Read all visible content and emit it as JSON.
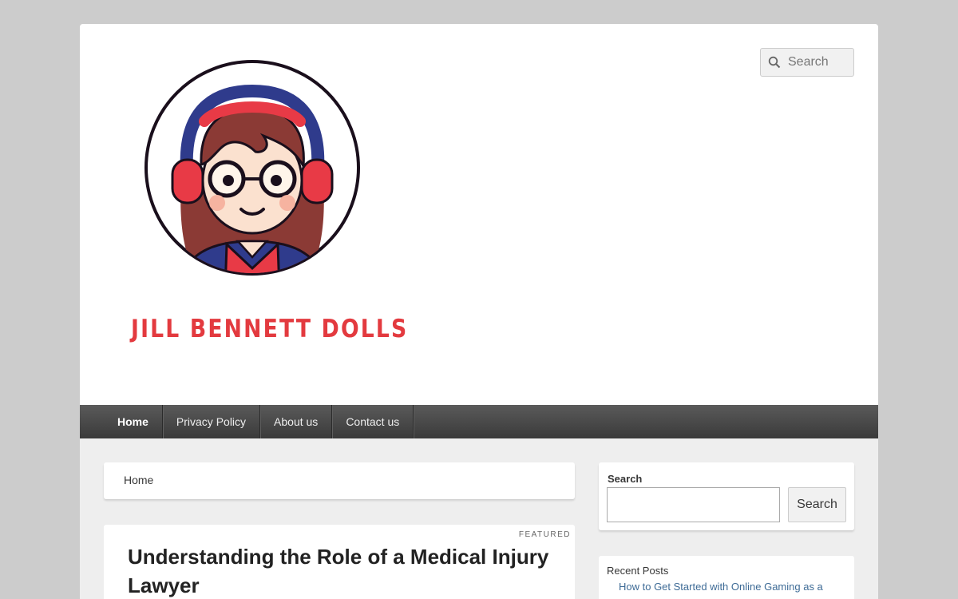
{
  "header": {
    "search_placeholder": "Search",
    "site_title": "JILL BENNETT DOLLS"
  },
  "nav": {
    "items": [
      "Home",
      "Privacy Policy",
      "About us",
      "Contact us"
    ]
  },
  "breadcrumb": {
    "label": "Home"
  },
  "post": {
    "badge": "FEATURED",
    "title": "Understanding the Role of a Medical Injury Lawyer"
  },
  "sidebar": {
    "search": {
      "label": "Search",
      "button": "Search"
    },
    "recent": {
      "label": "Recent Posts",
      "items": [
        "How to Get Started with Online Gaming as a"
      ]
    }
  },
  "colors": {
    "accent": "#e33a3f",
    "nav_bg": "#3a3a3a",
    "link": "#3e6b96"
  }
}
